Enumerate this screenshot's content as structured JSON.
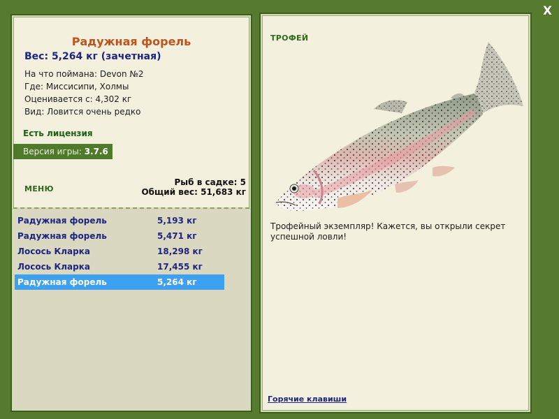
{
  "window": {
    "close_label": "X"
  },
  "fish_info": {
    "title": "Радужная форель",
    "weight_line": "Вес: 5,264 кг (зачетная)",
    "caught_on": "На что поймана: Devon №2",
    "location": "Где: Миссисипи, Холмы",
    "valued_from": "Оценивается с: 4,302 кг",
    "rarity": "Вид: Ловится очень редко"
  },
  "license": "Есть лицензия",
  "version": {
    "label": "Версия игры: ",
    "value": "3.7.6"
  },
  "menu_label": "МЕНЮ",
  "cage": {
    "count": "Рыб в садке: 5",
    "total_weight": "Общий вес: 51,683 кг"
  },
  "catch_list": [
    {
      "name": "Радужная форель",
      "weight": "5,193 кг",
      "selected": false
    },
    {
      "name": "Радужная форель",
      "weight": "5,471 кг",
      "selected": false
    },
    {
      "name": "Лосось Кларка",
      "weight": "18,298 кг",
      "selected": false
    },
    {
      "name": "Лосось Кларка",
      "weight": "17,455 кг",
      "selected": false
    },
    {
      "name": "Радужная форель",
      "weight": "5,264 кг",
      "selected": true
    }
  ],
  "trophy": {
    "label": "ТРОФЕЙ",
    "description": "Трофейный экземпляр! Кажется, вы открыли секрет успешной ловли!",
    "image_icon": "rainbow-trout-illustration"
  },
  "hotkeys_label": "Горячие клавиши",
  "colors": {
    "background": "#567a2e",
    "panel": "#f3f1dd",
    "title_orange": "#c0531c",
    "navy_text": "#1d2580",
    "selection_blue": "#3ea0f1",
    "list_bg": "#dad8c0"
  }
}
